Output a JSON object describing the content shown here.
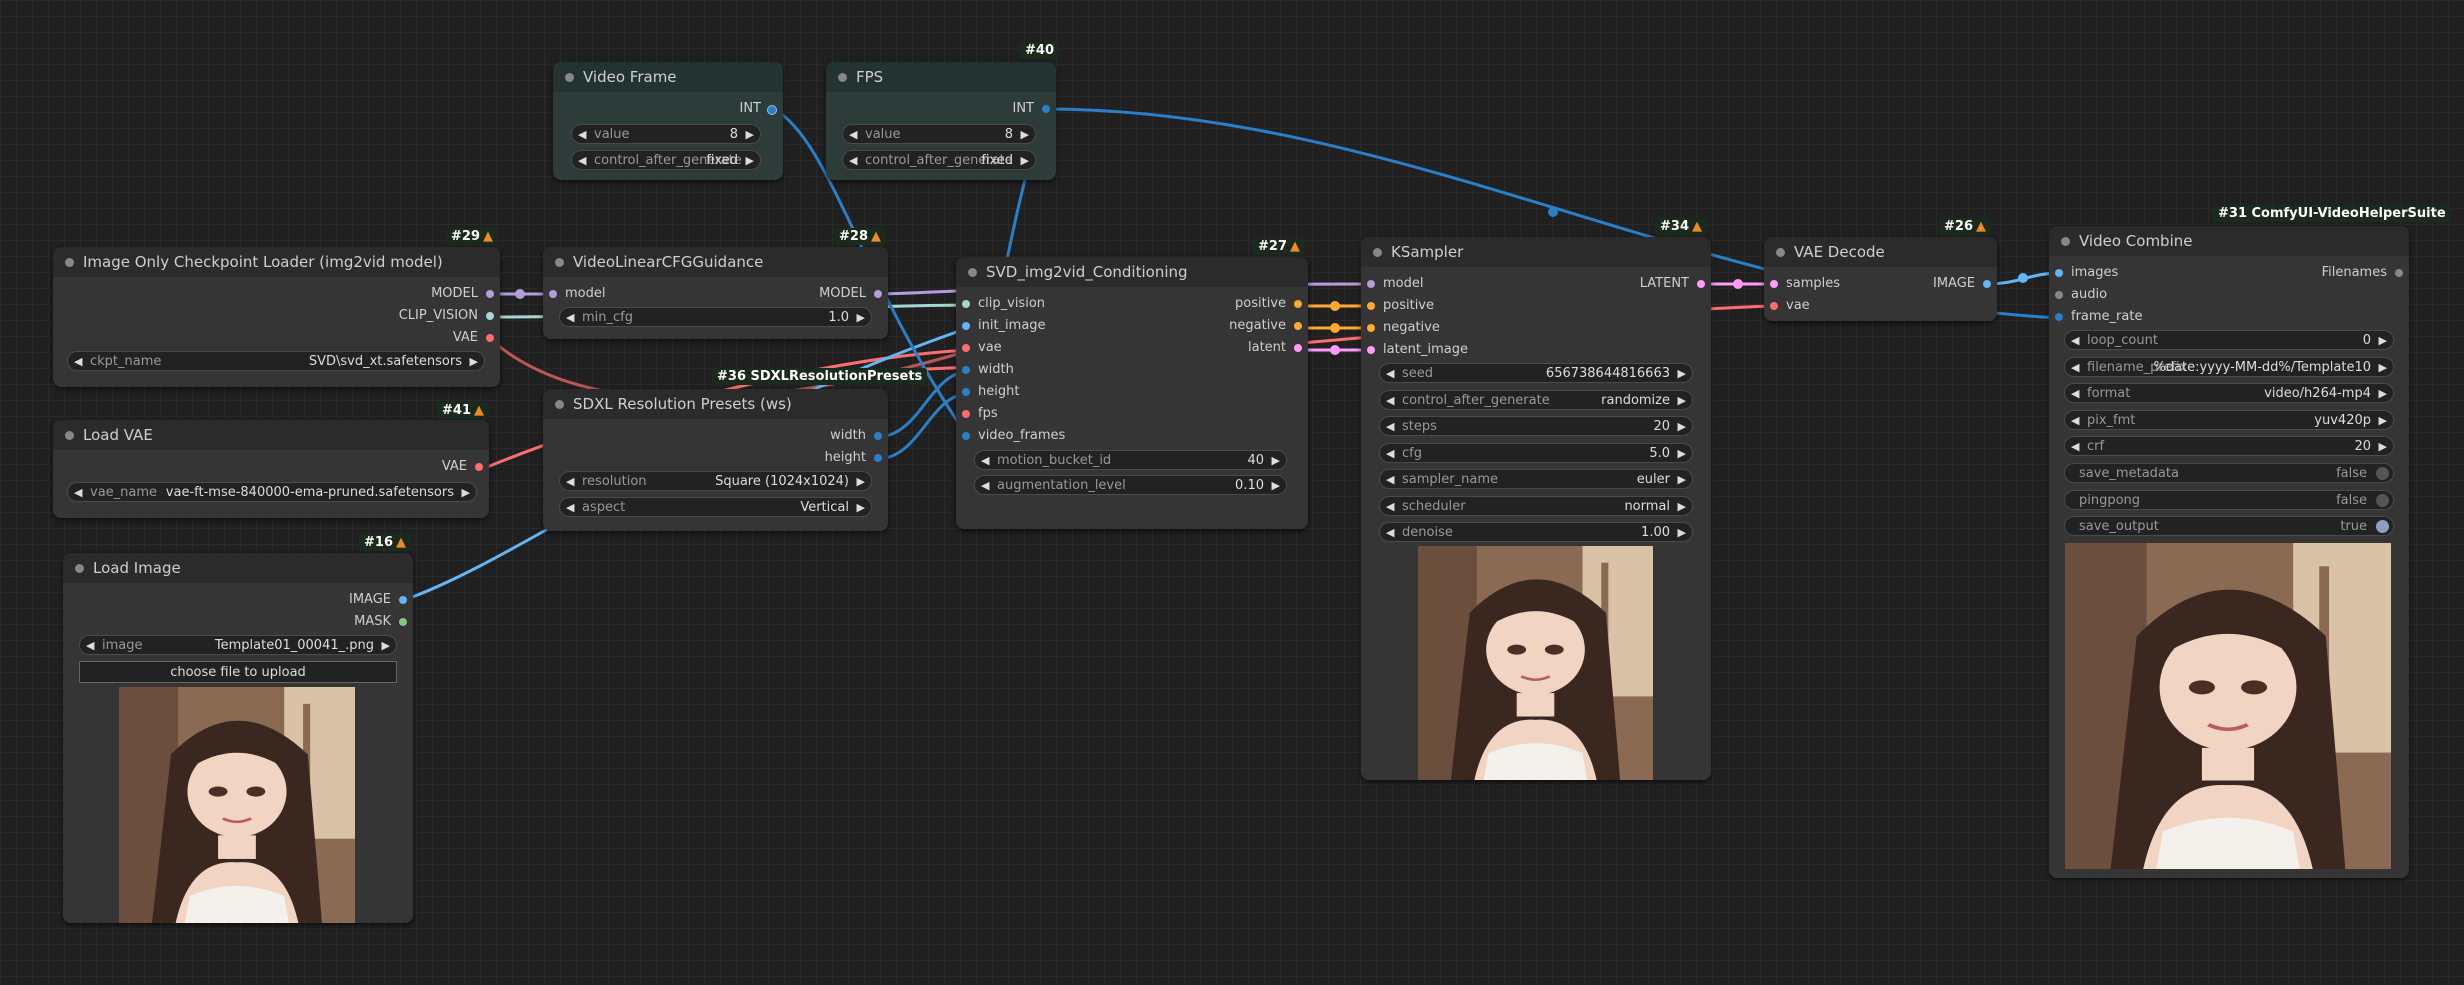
{
  "colors": {
    "model": "#b39ddb",
    "clip": "#ffd54f",
    "vae": "#ff6e6e",
    "int": "#2a7fc9",
    "image": "#64b5f6",
    "cond": "#ffa931",
    "latent": "#ff9cf9",
    "mask": "#81c784"
  },
  "nodes": {
    "video_frame": {
      "title": "Video Frame",
      "out": "INT",
      "w_value_label": "value",
      "w_value": "8",
      "w_cag_label": "control_after_generate",
      "w_cag": "fixed"
    },
    "fps": {
      "badge": "#40",
      "title": "FPS",
      "out": "INT",
      "w_value_label": "value",
      "w_value": "8",
      "w_cag_label": "control_after_generate",
      "w_cag": "fixed"
    },
    "ckpt": {
      "badge": "#29",
      "title": "Image Only Checkpoint Loader (img2vid model)",
      "out_model": "MODEL",
      "out_clip": "CLIP_VISION",
      "out_vae": "VAE",
      "w_label": "ckpt_name",
      "w_val": "SVD\\svd_xt.safetensors"
    },
    "cfg": {
      "badge": "#28",
      "title": "VideoLinearCFGGuidance",
      "in_model": "model",
      "out_model": "MODEL",
      "w_label": "min_cfg",
      "w_val": "1.0"
    },
    "svd": {
      "badge": "#27",
      "title": "SVD_img2vid_Conditioning",
      "in_clip": "clip_vision",
      "in_init": "init_image",
      "in_vae": "vae",
      "in_width": "width",
      "in_height": "height",
      "in_fps": "fps",
      "in_frames": "video_frames",
      "out_pos": "positive",
      "out_neg": "negative",
      "out_lat": "latent",
      "w1_label": "motion_bucket_id",
      "w1_val": "40",
      "w2_label": "augmentation_level",
      "w2_val": "0.10"
    },
    "ksampler": {
      "badge": "#34",
      "title": "KSampler",
      "in_model": "model",
      "in_pos": "positive",
      "in_neg": "negative",
      "in_lat": "latent_image",
      "out": "LATENT",
      "widgets": [
        {
          "label": "seed",
          "val": "656738644816663"
        },
        {
          "label": "control_after_generate",
          "val": "randomize"
        },
        {
          "label": "steps",
          "val": "20"
        },
        {
          "label": "cfg",
          "val": "5.0"
        },
        {
          "label": "sampler_name",
          "val": "euler"
        },
        {
          "label": "scheduler",
          "val": "normal"
        },
        {
          "label": "denoise",
          "val": "1.00"
        }
      ]
    },
    "vaedec": {
      "badge": "#26",
      "title": "VAE Decode",
      "in_samples": "samples",
      "in_vae": "vae",
      "out": "IMAGE"
    },
    "combine": {
      "badge": "#31 ComfyUI-VideoHelperSuite",
      "title": "Video Combine",
      "in_images": "images",
      "in_audio": "audio",
      "in_frame": "frame_rate",
      "out": "Filenames",
      "widgets": [
        {
          "label": "loop_count",
          "val": "0"
        },
        {
          "label": "filename_prefix",
          "val": "%date:yyyy-MM-dd%/Template10"
        },
        {
          "label": "format",
          "val": "video/h264-mp4"
        },
        {
          "label": "pix_fmt",
          "val": "yuv420p"
        },
        {
          "label": "crf",
          "val": "20"
        }
      ],
      "toggles": [
        {
          "label": "save_metadata",
          "val": "false"
        },
        {
          "label": "pingpong",
          "val": "false"
        },
        {
          "label": "save_output",
          "val": "true"
        }
      ]
    },
    "loadvae": {
      "badge": "#41",
      "title": "Load VAE",
      "out": "VAE",
      "w_label": "vae_name",
      "w_val": "vae-ft-mse-840000-ema-pruned.safetensors"
    },
    "sdxl": {
      "badge": "#36 SDXLResolutionPresets",
      "title": "SDXL Resolution Presets (ws)",
      "out_w": "width",
      "out_h": "height",
      "w1_label": "resolution",
      "w1_val": "Square (1024x1024)",
      "w2_label": "aspect",
      "w2_val": "Vertical"
    },
    "loadimg": {
      "badge": "#16",
      "title": "Load Image",
      "out_img": "IMAGE",
      "out_mask": "MASK",
      "w_label": "image",
      "w_val": "Template01_00041_.png",
      "button": "choose file to upload"
    }
  }
}
